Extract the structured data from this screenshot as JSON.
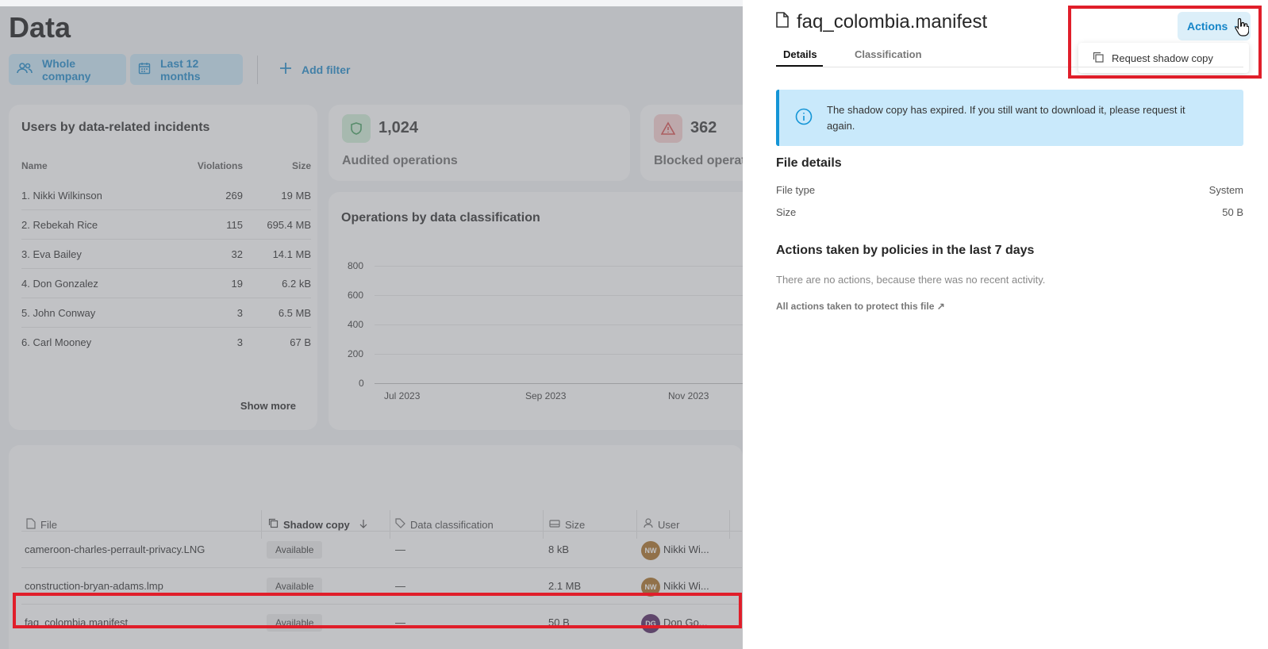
{
  "page": {
    "title": "Data",
    "filters": {
      "scope": "Whole company",
      "period": "Last 12 months",
      "add": "Add filter"
    }
  },
  "users_card": {
    "title": "Users by data-related incidents",
    "columns": [
      "Name",
      "Violations",
      "Size"
    ],
    "rows": [
      {
        "name": "1. Nikki Wilkinson",
        "violations": "269",
        "size": "19 MB"
      },
      {
        "name": "2. Rebekah Rice",
        "violations": "115",
        "size": "695.4 MB"
      },
      {
        "name": "3. Eva Bailey",
        "violations": "32",
        "size": "14.1 MB"
      },
      {
        "name": "4. Don Gonzalez",
        "violations": "19",
        "size": "6.2 kB"
      },
      {
        "name": "5. John Conway",
        "violations": "3",
        "size": "6.5 MB"
      },
      {
        "name": "6. Carl Mooney",
        "violations": "3",
        "size": "67 B"
      }
    ],
    "show_more": "Show more"
  },
  "stats": {
    "audited_value": "1,024",
    "audited_label": "Audited operations",
    "blocked_value": "362",
    "blocked_label": "Blocked operat",
    "audited_color": "#3f9e5c",
    "blocked_color": "#d64545"
  },
  "ops_chart": {
    "title": "Operations by data classification",
    "y_ticks": [
      "800",
      "600",
      "400",
      "200",
      "0"
    ],
    "x_ticks": [
      "Jul 2023",
      "Sep 2023",
      "Nov 2023"
    ]
  },
  "files_table": {
    "columns": {
      "file": "File",
      "shadow": "Shadow copy",
      "classification": "Data classification",
      "size": "Size",
      "user": "User"
    },
    "rows": [
      {
        "file": "cameroon-charles-perrault-privacy.LNG",
        "shadow": "Available",
        "classification": "—",
        "size": "8 kB",
        "initials": "NW",
        "user": "Nikki Wi...",
        "avatar_color": "#a66a1c"
      },
      {
        "file": "construction-bryan-adams.lmp",
        "shadow": "Available",
        "classification": "—",
        "size": "2.1 MB",
        "initials": "NW",
        "user": "Nikki Wi...",
        "avatar_color": "#a66a1c"
      },
      {
        "file": "faq_colombia.manifest",
        "shadow": "Available",
        "classification": "—",
        "size": "50 B",
        "initials": "DG",
        "user": "Don Go...",
        "avatar_color": "#4b1a5a"
      }
    ]
  },
  "panel": {
    "file_name": "faq_colombia.manifest",
    "actions_label": "Actions",
    "menu_item": "Request shadow copy",
    "tabs": [
      "Details",
      "Classification"
    ],
    "info_text": "The shadow copy has expired. If you still want to download it, please request it again.",
    "file_details_title": "File details",
    "file_type_label": "File type",
    "file_type_value": "System",
    "size_label": "Size",
    "size_value": "50 B",
    "policies_title": "Actions taken by policies in the last 7 days",
    "no_actions": "There are no actions, because there was no recent activity.",
    "all_actions_link": "All actions taken to protect this file ↗"
  },
  "colors": {
    "accent": "#1585c8",
    "highlight": "#e01e2a"
  }
}
